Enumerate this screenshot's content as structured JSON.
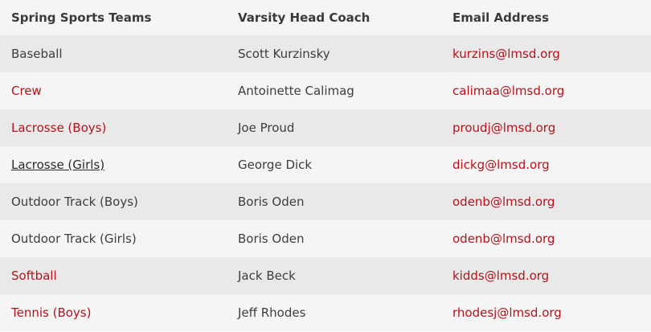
{
  "table": {
    "headers": {
      "team": "Spring Sports Teams",
      "coach": "Varsity Head Coach",
      "email": "Email Address"
    },
    "rows": [
      {
        "team": "Baseball",
        "team_link": false,
        "coach": "Scott Kurzinsky",
        "email": "kurzins@lmsd.org"
      },
      {
        "team": "Crew",
        "team_link": true,
        "coach": "Antoinette Calimag",
        "email": "calimaa@lmsd.org"
      },
      {
        "team": "Lacrosse (Boys)",
        "team_link": true,
        "coach": "Joe Proud",
        "email": "proudj@lmsd.org"
      },
      {
        "team": "Lacrosse (Girls)",
        "team_link": true,
        "coach": "George Dick",
        "email": "dickg@lmsd.org"
      },
      {
        "team": "Outdoor Track (Boys)",
        "team_link": false,
        "coach": "Boris Oden",
        "email": "odenb@lmsd.org"
      },
      {
        "team": "Outdoor Track (Girls)",
        "team_link": false,
        "coach": "Boris Oden",
        "email": "odenb@lmsd.org"
      },
      {
        "team": "Softball",
        "team_link": true,
        "coach": "Jack Beck",
        "email": "kidds@lmsd.org"
      },
      {
        "team": "Tennis (Boys)",
        "team_link": true,
        "coach": "Jeff Rhodes",
        "email": "rhodesj@lmsd.org"
      }
    ]
  },
  "colors": {
    "link": "#b5121b",
    "text": "#3d3d3d",
    "row_dark": "#e9e9e9",
    "row_light": "#f5f5f5"
  }
}
